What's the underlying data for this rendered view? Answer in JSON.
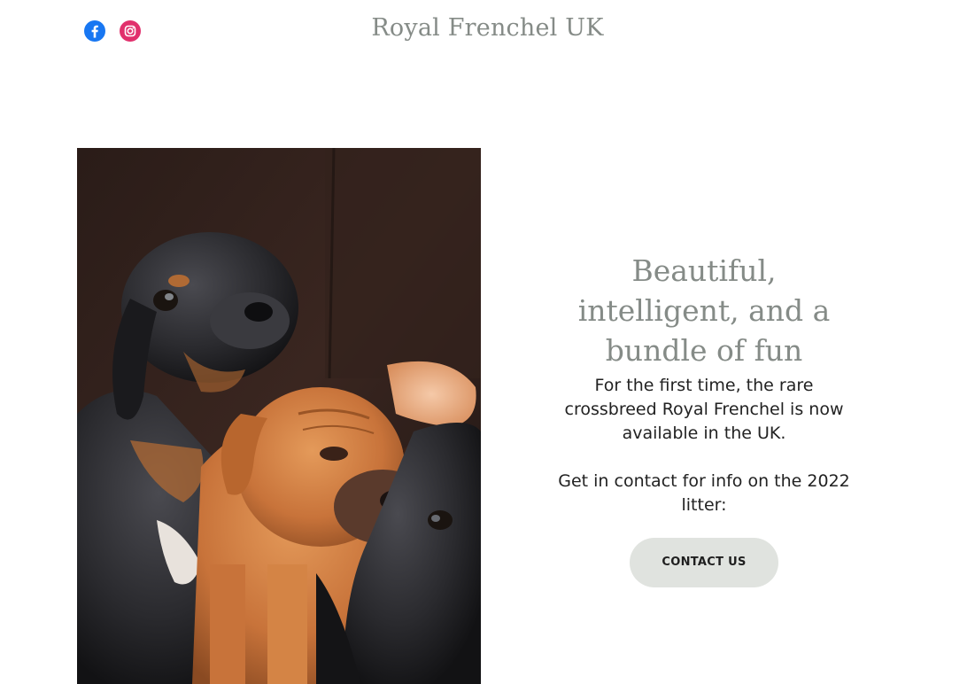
{
  "header": {
    "site_title": "Royal Frenchel UK",
    "social": [
      {
        "icon": "facebook-icon",
        "color": "#1877f2"
      },
      {
        "icon": "instagram-icon",
        "color": "#e1306c"
      }
    ]
  },
  "hero": {
    "image_icon": "puppies-photo",
    "headline": "Beautiful, intelligent, and a bundle of fun",
    "paragraph_1": "For the first time, the rare crossbreed Royal Frenchel is now available in the UK.",
    "paragraph_2": "Get in contact for info on the 2022 litter:",
    "cta_label": "CONTACT US"
  },
  "colors": {
    "title_gray": "#858b87",
    "button_bg": "#e0e3df",
    "text": "#222222"
  }
}
